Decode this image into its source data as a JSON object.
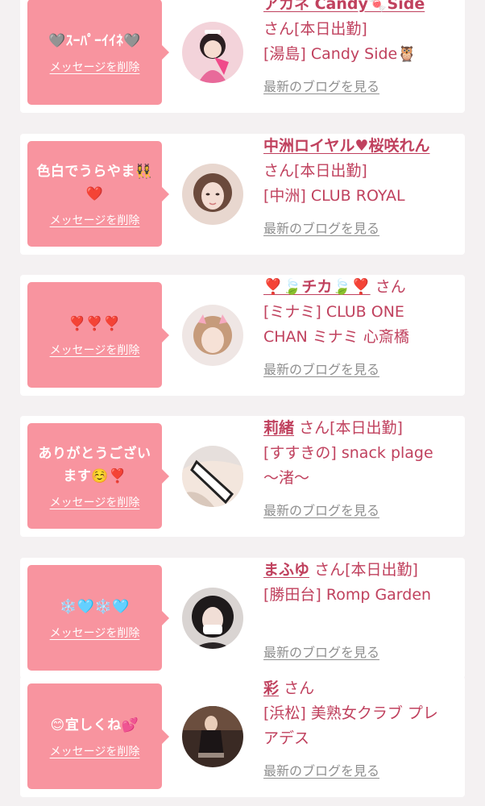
{
  "cards": [
    {
      "message": "🩶ｽｰﾊﾟｰｲｲﾈ🩶",
      "delete_label": "メッセージを削除",
      "name": "アカネ Candy🍬Side",
      "status": "さん[本日出勤]",
      "shop": "[湯島] Candy Side🦉",
      "blog_label": "最新のブログを見る"
    },
    {
      "message": "色白でうらやま👯‍♀️❤️",
      "delete_label": "メッセージを削除",
      "name": "中洲ロイヤル♥桜咲れん",
      "status": "さん[本日出勤]",
      "shop": "[中洲] CLUB ROYAL",
      "blog_label": "最新のブログを見る"
    },
    {
      "message": "❣️❣️❣️",
      "delete_label": "メッセージを削除",
      "name": "❣️🍃チカ🍃❣️",
      "status": "さん",
      "shop": "[ミナミ] CLUB ONE CHAN ミナミ 心斎橋",
      "blog_label": "最新のブログを見る"
    },
    {
      "message": "ありがとうございます☺️❣️",
      "delete_label": "メッセージを削除",
      "name": "莉緒",
      "status": "さん[本日出勤]",
      "shop": "[すすきの] snack plage ～渚～",
      "blog_label": "最新のブログを見る"
    },
    {
      "message": "❄️🩵❄️🩵",
      "delete_label": "メッセージを削除",
      "name": "まふゆ",
      "status": "さん[本日出勤]",
      "shop": "[勝田台] Romp Garden",
      "blog_label": "最新のブログを見る"
    },
    {
      "message": "😊宜しくね💕",
      "delete_label": "メッセージを削除",
      "name": "彩",
      "status": "さん",
      "shop": "[浜松] 美熟女クラブ プレアデス",
      "blog_label": "最新のブログを見る"
    }
  ],
  "colors": {
    "bubble": "#f8949f",
    "accent_text": "#c0415e",
    "link_grey": "#8f8f8f",
    "background": "#f4f1f2"
  }
}
